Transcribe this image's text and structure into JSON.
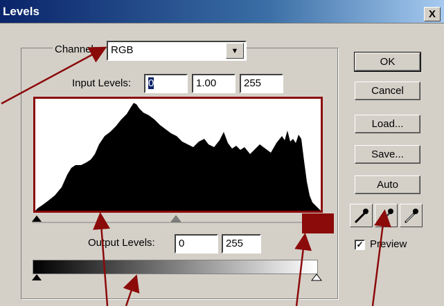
{
  "window": {
    "title": "Levels",
    "close_label": "X"
  },
  "channel": {
    "label": "Channel:",
    "value": "RGB",
    "drop_glyph": "▼"
  },
  "input_levels": {
    "label": "Input Levels:",
    "black": "0",
    "gamma": "1.00",
    "white": "255"
  },
  "output_levels": {
    "label": "Output Levels:",
    "black": "0",
    "white": "255"
  },
  "buttons": {
    "ok": "OK",
    "cancel": "Cancel",
    "load": "Load...",
    "save": "Save...",
    "auto": "Auto"
  },
  "preview": {
    "label": "Preview",
    "checked": true,
    "check_glyph": "✓"
  },
  "icons": [
    "black-eyedropper-icon",
    "gray-eyedropper-icon",
    "white-eyedropper-icon"
  ],
  "colors": {
    "annotation": "#8b0a0a",
    "title_bar": "#0a246a"
  }
}
